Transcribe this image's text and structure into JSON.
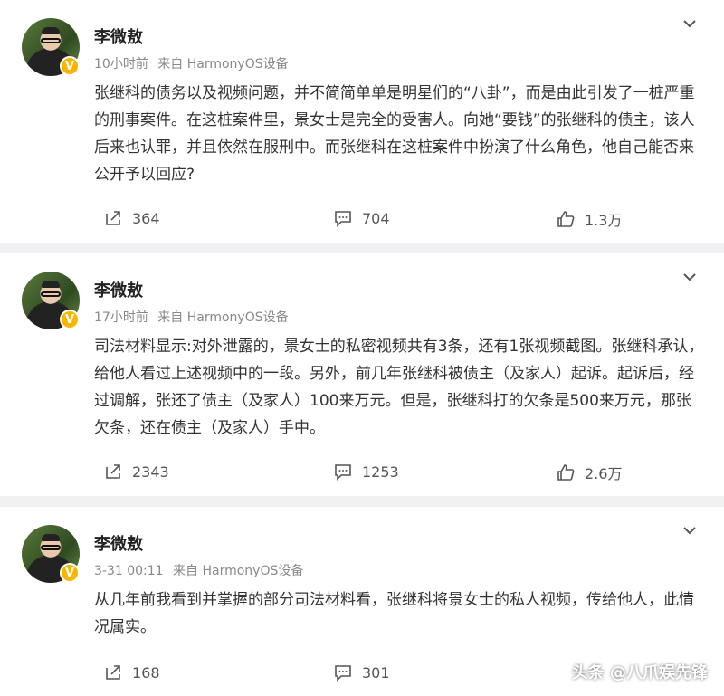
{
  "posts": [
    {
      "author": "李微敖",
      "time": "10小时前",
      "source": "来自 HarmonyOS设备",
      "text": "张继科的债务以及视频问题，并不简简单单是明星们的“八卦”，而是由此引发了一桩严重的刑事案件。在这桩案件里，景女士是完全的受害人。向她“要钱”的张继科的债主，该人后来也认罪，并且依然在服刑中。而张继科在这桩案件中扮演了什么角色，他自己能否来公开予以回应?",
      "reposts": "364",
      "comments": "704",
      "likes": "1.3万"
    },
    {
      "author": "李微敖",
      "time": "17小时前",
      "source": "来自 HarmonyOS设备",
      "text": "司法材料显示:对外泄露的，景女士的私密视频共有3条，还有1张视频截图。张继科承认，给他人看过上述视频中的一段。另外，前几年张继科被债主（及家人）起诉。起诉后，经过调解，张还了债主（及家人）100来万元。但是，张继科打的欠条是500来万元，那张欠条，还在债主（及家人）手中。",
      "reposts": "2343",
      "comments": "1253",
      "likes": "2.6万"
    },
    {
      "author": "李微敖",
      "time": "3-31 00:11",
      "source": "来自 HarmonyOS设备",
      "text": "从几年前我看到并掌握的部分司法材料看，张继科将景女士的私人视频，传给他人，此情况属实。",
      "reposts": "168",
      "comments": "301",
      "likes": ""
    }
  ],
  "watermark": "头条 @八爪娱先锋",
  "colors": {
    "background": "#f0f0f2",
    "card": "#ffffff",
    "badge": "#f7b500",
    "meta": "#888888"
  }
}
